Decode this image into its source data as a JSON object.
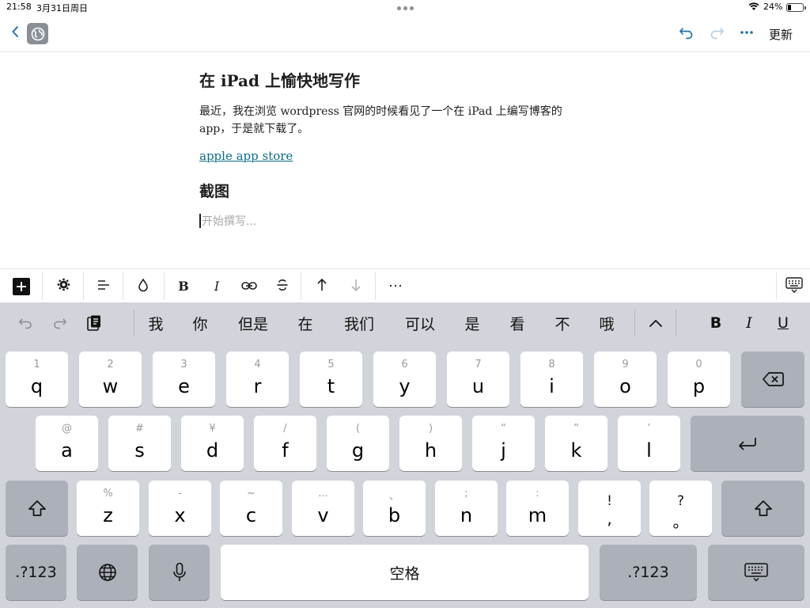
{
  "status_bar": {
    "time": "21:58",
    "date": "3月31日周日",
    "battery_percent": "24%",
    "battery_level": 0.24
  },
  "header": {
    "update_label": "更新"
  },
  "post": {
    "title": "在 iPad 上愉快地写作",
    "paragraph": "最近，我在浏览 wordpress 官网的时候看见了一个在 iPad 上编写博客的 app，于是就下载了。",
    "link_text": "apple app store",
    "heading": "截图",
    "placeholder": "开始撰写..."
  },
  "format_toolbar": {
    "bold": "B",
    "italic": "I",
    "more": "⋯"
  },
  "suggestions": {
    "candidates": [
      "我",
      "你",
      "但是",
      "在",
      "我们",
      "可以",
      "是",
      "看",
      "不",
      "哦"
    ],
    "bold": "B",
    "italic": "I",
    "underline": "U"
  },
  "keyboard": {
    "row1": [
      {
        "pri": "q",
        "sec": "1"
      },
      {
        "pri": "w",
        "sec": "2"
      },
      {
        "pri": "e",
        "sec": "3"
      },
      {
        "pri": "r",
        "sec": "4"
      },
      {
        "pri": "t",
        "sec": "5"
      },
      {
        "pri": "y",
        "sec": "6"
      },
      {
        "pri": "u",
        "sec": "7"
      },
      {
        "pri": "i",
        "sec": "8"
      },
      {
        "pri": "o",
        "sec": "9"
      },
      {
        "pri": "p",
        "sec": "0"
      }
    ],
    "row2": [
      {
        "pri": "a",
        "sec": "@"
      },
      {
        "pri": "s",
        "sec": "#"
      },
      {
        "pri": "d",
        "sec": "¥"
      },
      {
        "pri": "f",
        "sec": "/"
      },
      {
        "pri": "g",
        "sec": "("
      },
      {
        "pri": "h",
        "sec": ")"
      },
      {
        "pri": "j",
        "sec": "“"
      },
      {
        "pri": "k",
        "sec": "”"
      },
      {
        "pri": "l",
        "sec": "’"
      }
    ],
    "row3": [
      {
        "pri": "z",
        "sec": "%"
      },
      {
        "pri": "x",
        "sec": "-"
      },
      {
        "pri": "c",
        "sec": "~"
      },
      {
        "pri": "v",
        "sec": "..."
      },
      {
        "pri": "b",
        "sec": "、"
      },
      {
        "pri": "n",
        "sec": ";"
      },
      {
        "pri": "m",
        "sec": ":"
      }
    ],
    "punct": [
      {
        "pri": ",",
        "sec": "!"
      },
      {
        "pri": "。",
        "sec": "?"
      }
    ],
    "numbers_label": ".?123",
    "space_label": "空格"
  }
}
